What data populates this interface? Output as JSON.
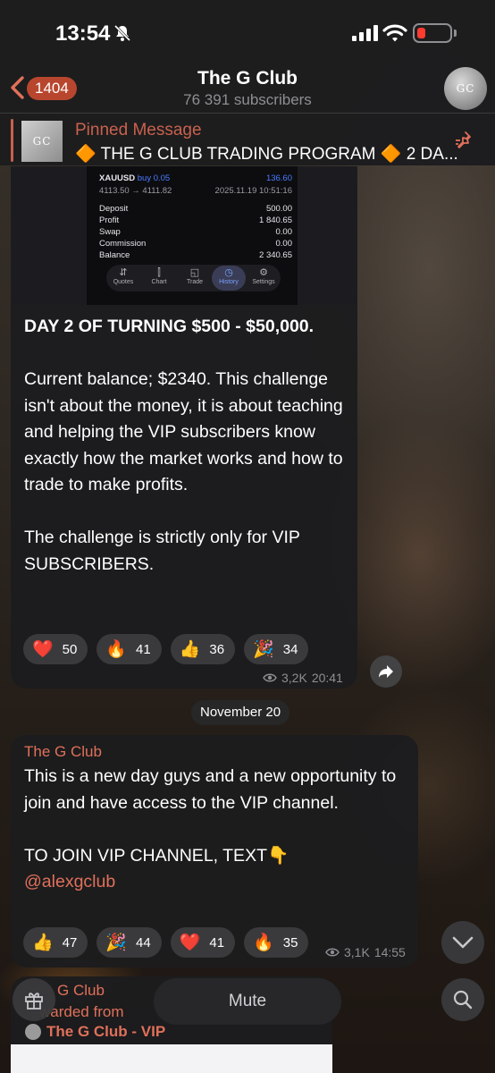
{
  "status_bar": {
    "time": "13:54"
  },
  "header": {
    "back_count": "1404",
    "title": "The G Club",
    "subtitle": "76 391 subscribers",
    "avatar_text": "GC"
  },
  "pinned": {
    "label": "Pinned Message",
    "text": "🔶 THE G CLUB TRADING PROGRAM 🔶 2 DA..."
  },
  "trade_screenshot": {
    "symbol": "XAUUSD",
    "side": "buy 0.05",
    "profit_head": "136.60",
    "price_range": "4113.50 → 4111.82",
    "datetime": "2025.11.19 10:51:16",
    "rows": [
      {
        "label": "Deposit",
        "value": "500.00"
      },
      {
        "label": "Profit",
        "value": "1 840.65"
      },
      {
        "label": "Swap",
        "value": "0.00"
      },
      {
        "label": "Commission",
        "value": "0.00"
      },
      {
        "label": "Balance",
        "value": "2 340.65"
      }
    ],
    "tabs": [
      "Quotes",
      "Chart",
      "Trade",
      "History",
      "Settings"
    ],
    "active_tab": "History"
  },
  "message1": {
    "title": "DAY 2 OF TURNING $500 - $50,000.",
    "body1": "Current balance; $2340. This challenge isn't about the money, it is about teaching and helping the VIP subscribers know exactly how the market works and how to trade to make profits.",
    "body2": "The challenge is strictly only for VIP SUBSCRIBERS.",
    "reactions": [
      {
        "emoji": "❤️",
        "count": "50"
      },
      {
        "emoji": "🔥",
        "count": "41"
      },
      {
        "emoji": "👍",
        "count": "36"
      },
      {
        "emoji": "🎉",
        "count": "34"
      }
    ],
    "views": "3,2K",
    "time": "20:41"
  },
  "date_separator": "November 20",
  "message2": {
    "sender": "The G Club",
    "body1": "This is a new day guys and a new opportunity to join and have access to the VIP channel.",
    "body2": "TO JOIN VIP CHANNEL, TEXT👇",
    "link": "@alexgclub",
    "reactions": [
      {
        "emoji": "👍",
        "count": "47"
      },
      {
        "emoji": "🎉",
        "count": "44"
      },
      {
        "emoji": "❤️",
        "count": "41"
      },
      {
        "emoji": "🔥",
        "count": "35"
      }
    ],
    "views": "3,1K",
    "time": "14:55"
  },
  "message3": {
    "sender": "G Club",
    "forwarded_label": "warded from",
    "forwarded_name": "The G Club - VIP"
  },
  "bottom_bar": {
    "mute_label": "Mute"
  },
  "colors": {
    "accent": "#e0705a",
    "bubble": "#1c1c1e",
    "reaction_bg": "#3a3a3c"
  }
}
